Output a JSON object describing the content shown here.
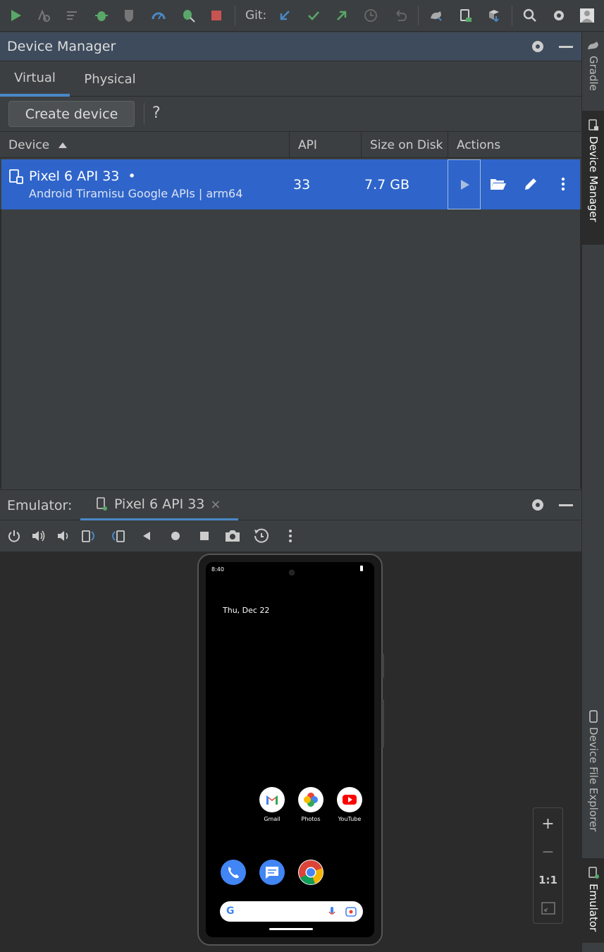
{
  "toolbar": {
    "git_label": "Git:"
  },
  "device_manager": {
    "title": "Device Manager",
    "tabs": [
      "Virtual",
      "Physical"
    ],
    "active_tab": "Virtual",
    "create_button": "Create device",
    "help": "?",
    "columns": [
      "Device",
      "API",
      "Size on Disk",
      "Actions"
    ],
    "rows": [
      {
        "name": "Pixel 6 API 33",
        "status_dot": "•",
        "subtitle": "Android Tiramisu Google APIs | arm64",
        "api": "33",
        "size": "7.7 GB"
      }
    ]
  },
  "emulator": {
    "label": "Emulator:",
    "tab_title": "Pixel 6 API 33",
    "close": "×",
    "screen": {
      "time": "8:40",
      "date": "Thu, Dec 22",
      "apps": [
        "Gmail",
        "Photos",
        "YouTube"
      ]
    },
    "zoom": {
      "zoom_in": "+",
      "zoom_out": "−",
      "actual": "1:1"
    }
  },
  "side_tabs": [
    "Gradle",
    "Device Manager",
    "Device File Explorer",
    "Emulator"
  ],
  "colors": {
    "accent": "#4a88c7",
    "selection": "#2f65ca",
    "run_green": "#59a869",
    "stop_red": "#c75450"
  }
}
